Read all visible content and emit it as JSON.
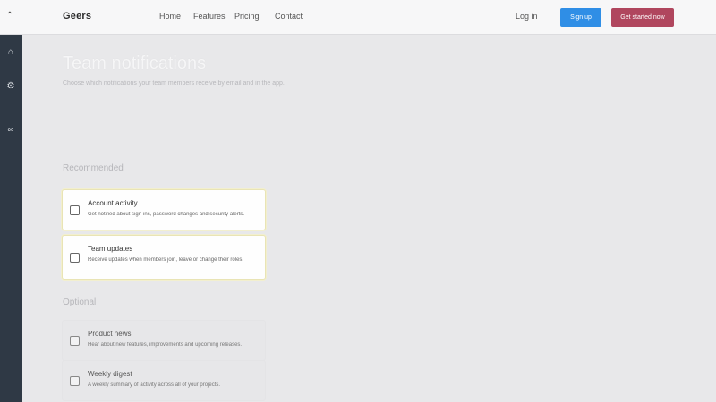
{
  "header": {
    "menu_icon": "chevron-icon",
    "brand": "Geers",
    "nav": [
      "Home",
      "Features",
      "Pricing",
      "Contact"
    ],
    "right_link": "Log in",
    "primary_button": "Sign up",
    "secondary_button": "Get started now"
  },
  "sidebar": {
    "icons": [
      "home-icon",
      "settings-icon",
      "link-icon"
    ]
  },
  "main": {
    "title": "Team notifications",
    "subtitle": "Choose which notifications your team members receive by email and in the app.",
    "sections": [
      {
        "label": "Recommended",
        "items": [
          {
            "title": "Account activity",
            "description": "Get notified about sign-ins, password changes and security alerts.",
            "checked": false
          },
          {
            "title": "Team updates",
            "description": "Receive updates when members join, leave or change their roles."
          }
        ]
      },
      {
        "label": "Optional",
        "items": [
          {
            "title": "Product news",
            "description": "Hear about new features, improvements and upcoming releases."
          },
          {
            "title": "Weekly digest",
            "description": "A weekly summary of activity across all of your projects."
          }
        ]
      }
    ]
  },
  "colors": {
    "primary": "#2f8ee6",
    "secondary": "#b0465e",
    "rail": "#2f3945",
    "active_border": "#e9e4b5"
  }
}
